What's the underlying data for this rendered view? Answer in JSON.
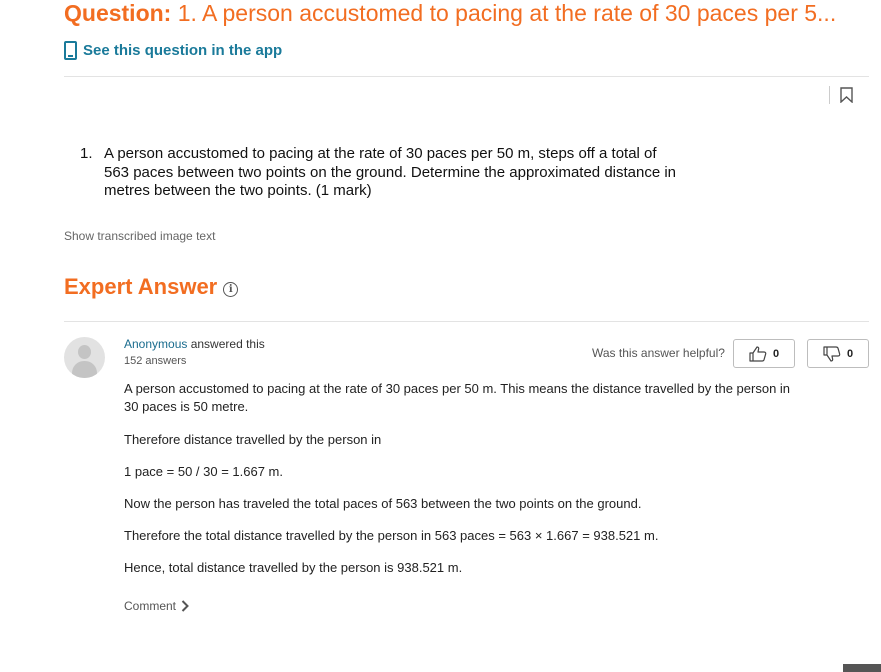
{
  "question": {
    "label": "Question:",
    "title_text": "1. A person accustomed to pacing at the rate of 30 paces per 5...",
    "app_link": "See this question in the app",
    "number": "1.",
    "body": "A person accustomed to pacing at the rate of 30 paces per 50 m, steps off a total of 563 paces between two points on the ground.  Determine the approximated distance in metres between the two points.  (1 mark)",
    "show_transcribed": "Show transcribed image text"
  },
  "expert": {
    "title": "Expert Answer",
    "info_icon": "i"
  },
  "answer": {
    "author": "Anonymous",
    "answered_text": " answered this",
    "answers_count": "152 answers",
    "helpful_label": "Was this answer helpful?",
    "thumbs_up_count": "0",
    "thumbs_down_count": "0",
    "paragraphs": [
      "A person accustomed to pacing at the rate of 30 paces per 50 m. This means the distance travelled by the person in 30 paces is 50 metre.",
      "Therefore distance travelled by the person in",
      "1 pace = 50 / 30 = 1.667 m.",
      "Now the person has traveled the total paces of 563 between the two points on the ground.",
      "Therefore the total distance travelled by the person in 563 paces = 563 × 1.667 = 938.521 m.",
      "Hence, total distance travelled by the person is 938.521 m."
    ],
    "comment_label": "Comment"
  },
  "icons": {
    "phone": "phone-icon",
    "bookmark": "bookmark-icon",
    "info": "info-icon",
    "avatar": "avatar-placeholder",
    "thumbs_up": "thumbs-up-icon",
    "thumbs_down": "thumbs-down-icon",
    "chevron": "chevron-right-icon"
  },
  "colors": {
    "accent_orange": "#f26d21",
    "link_teal": "#1a7a9a"
  }
}
